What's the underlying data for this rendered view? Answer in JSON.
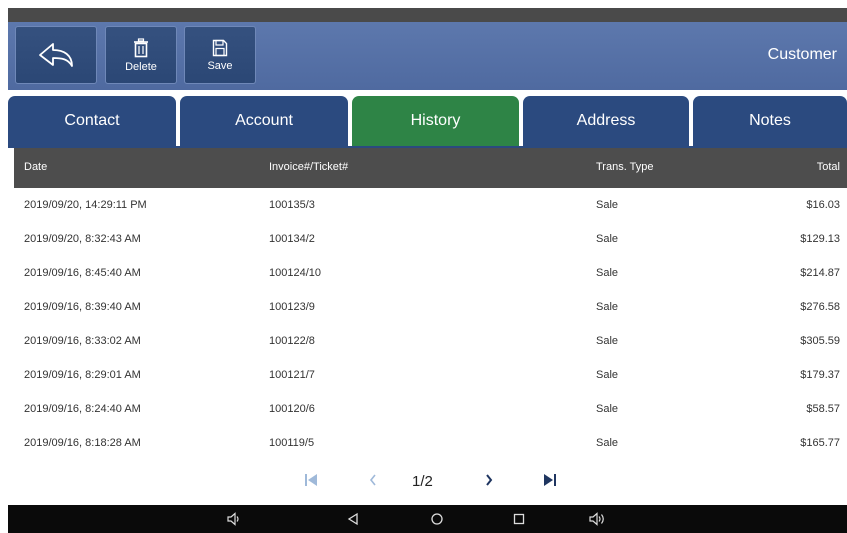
{
  "header": {
    "title": "Customer",
    "buttons": {
      "delete": "Delete",
      "save": "Save"
    }
  },
  "tabs": [
    {
      "label": "Contact"
    },
    {
      "label": "Account"
    },
    {
      "label": "History"
    },
    {
      "label": "Address"
    },
    {
      "label": "Notes"
    }
  ],
  "active_tab": "History",
  "table": {
    "columns": {
      "date": "Date",
      "invoice": "Invoice#/Ticket#",
      "type": "Trans. Type",
      "total": "Total"
    },
    "rows": [
      {
        "date": "2019/09/20, 14:29:11 PM",
        "invoice": "100135/3",
        "type": "Sale",
        "total": "$16.03"
      },
      {
        "date": "2019/09/20, 8:32:43 AM",
        "invoice": "100134/2",
        "type": "Sale",
        "total": "$129.13"
      },
      {
        "date": "2019/09/16, 8:45:40 AM",
        "invoice": "100124/10",
        "type": "Sale",
        "total": "$214.87"
      },
      {
        "date": "2019/09/16, 8:39:40 AM",
        "invoice": "100123/9",
        "type": "Sale",
        "total": "$276.58"
      },
      {
        "date": "2019/09/16, 8:33:02 AM",
        "invoice": "100122/8",
        "type": "Sale",
        "total": "$305.59"
      },
      {
        "date": "2019/09/16, 8:29:01 AM",
        "invoice": "100121/7",
        "type": "Sale",
        "total": "$179.37"
      },
      {
        "date": "2019/09/16, 8:24:40 AM",
        "invoice": "100120/6",
        "type": "Sale",
        "total": "$58.57"
      },
      {
        "date": "2019/09/16, 8:18:28 AM",
        "invoice": "100119/5",
        "type": "Sale",
        "total": "$165.77"
      }
    ]
  },
  "pagination": {
    "page_info": "1/2"
  },
  "icons": {
    "back": "back-arrow-icon",
    "delete": "trash-icon",
    "save": "floppy-disk-icon",
    "first_page": "first-page-icon",
    "prev_page": "chevron-left-icon",
    "next_page": "chevron-right-icon",
    "last_page": "last-page-icon",
    "volume_down": "volume-down-icon",
    "nav_back": "android-back-icon",
    "home": "android-home-icon",
    "recents": "android-recents-icon",
    "volume_up": "volume-up-icon"
  },
  "colors": {
    "toolbar": "#5670a6",
    "button": "#2f4b7a",
    "tab": "#2b4a7f",
    "tab_active": "#2e8446",
    "table_header": "#4d4d4d",
    "pager_disabled": "#9fb9d9",
    "pager_enabled": "#1f3560"
  }
}
